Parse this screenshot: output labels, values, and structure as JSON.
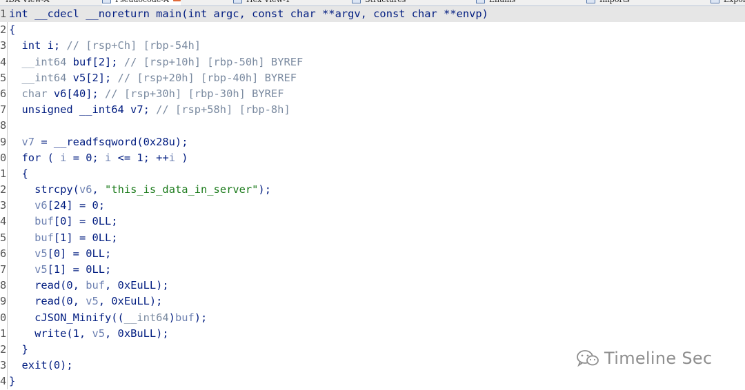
{
  "tabs": [
    {
      "label": "IDA View-A",
      "active": false
    },
    {
      "label": "Pseudocode-A",
      "active": true
    },
    {
      "label": "Hex View-1",
      "active": false
    },
    {
      "label": "Structures",
      "active": false
    },
    {
      "label": "Enums",
      "active": false
    },
    {
      "label": "Imports",
      "active": false
    },
    {
      "label": "Exports",
      "active": false
    }
  ],
  "code_lines": [
    {
      "no": "1",
      "hl": true,
      "parts": [
        [
          "k",
          "int __cdecl __noreturn main(int argc, const char **argv, const char **envp)"
        ]
      ]
    },
    {
      "no": "2",
      "parts": [
        [
          "k",
          "{"
        ]
      ]
    },
    {
      "no": "3",
      "parts": [
        [
          "k",
          "  int i; "
        ],
        [
          "c",
          "// [rsp+Ch] [rbp-54h]"
        ]
      ]
    },
    {
      "no": "4",
      "parts": [
        [
          "c",
          "  __int64 "
        ],
        [
          "k",
          "buf[2]; "
        ],
        [
          "c",
          "// [rsp+10h] [rbp-50h] BYREF"
        ]
      ]
    },
    {
      "no": "5",
      "parts": [
        [
          "c",
          "  __int64 "
        ],
        [
          "k",
          "v5[2]; "
        ],
        [
          "c",
          "// [rsp+20h] [rbp-40h] BYREF"
        ]
      ]
    },
    {
      "no": "6",
      "parts": [
        [
          "c",
          "  char "
        ],
        [
          "k",
          "v6[40]; "
        ],
        [
          "c",
          "// [rsp+30h] [rbp-30h] BYREF"
        ]
      ]
    },
    {
      "no": "7",
      "parts": [
        [
          "k",
          "  unsigned __int64 v7; "
        ],
        [
          "c",
          "// [rsp+58h] [rbp-8h]"
        ]
      ]
    },
    {
      "no": "8",
      "parts": [
        [
          "k",
          ""
        ]
      ]
    },
    {
      "no": "9",
      "parts": [
        [
          "v",
          "  v7"
        ],
        [
          "k",
          " = __readfsqword(0x28u);"
        ]
      ]
    },
    {
      "no": "0",
      "parts": [
        [
          "k",
          "  for ( "
        ],
        [
          "v",
          "i"
        ],
        [
          "k",
          " = 0; "
        ],
        [
          "v",
          "i"
        ],
        [
          "k",
          " <= 1; ++"
        ],
        [
          "v",
          "i"
        ],
        [
          "k",
          " )"
        ]
      ]
    },
    {
      "no": "1",
      "parts": [
        [
          "k",
          "  {"
        ]
      ]
    },
    {
      "no": "2",
      "parts": [
        [
          "k",
          "    strcpy("
        ],
        [
          "v",
          "v6"
        ],
        [
          "k",
          ", "
        ],
        [
          "s",
          "\"this_is_data_in_server\""
        ],
        [
          "k",
          ");"
        ]
      ]
    },
    {
      "no": "3",
      "parts": [
        [
          "v",
          "    v6"
        ],
        [
          "k",
          "[24] = 0;"
        ]
      ]
    },
    {
      "no": "4",
      "parts": [
        [
          "v",
          "    buf"
        ],
        [
          "k",
          "[0] = 0LL;"
        ]
      ]
    },
    {
      "no": "5",
      "parts": [
        [
          "v",
          "    buf"
        ],
        [
          "k",
          "[1] = 0LL;"
        ]
      ]
    },
    {
      "no": "6",
      "parts": [
        [
          "v",
          "    v5"
        ],
        [
          "k",
          "[0] = 0LL;"
        ]
      ]
    },
    {
      "no": "7",
      "parts": [
        [
          "v",
          "    v5"
        ],
        [
          "k",
          "[1] = 0LL;"
        ]
      ]
    },
    {
      "no": "8",
      "parts": [
        [
          "k",
          "    read(0, "
        ],
        [
          "v",
          "buf"
        ],
        [
          "k",
          ", 0xEuLL);"
        ]
      ]
    },
    {
      "no": "9",
      "parts": [
        [
          "k",
          "    read(0, "
        ],
        [
          "v",
          "v5"
        ],
        [
          "k",
          ", 0xEuLL);"
        ]
      ]
    },
    {
      "no": "0",
      "parts": [
        [
          "k",
          "    cJSON_Minify(("
        ],
        [
          "c",
          "__int64"
        ],
        [
          "k",
          ")"
        ],
        [
          "v",
          "buf"
        ],
        [
          "k",
          ");"
        ]
      ]
    },
    {
      "no": "1",
      "parts": [
        [
          "k",
          "    write(1, "
        ],
        [
          "v",
          "v5"
        ],
        [
          "k",
          ", 0xBuLL);"
        ]
      ]
    },
    {
      "no": "2",
      "parts": [
        [
          "k",
          "  }"
        ]
      ]
    },
    {
      "no": "3",
      "parts": [
        [
          "k",
          "  exit(0);"
        ]
      ]
    },
    {
      "no": "4",
      "parts": [
        [
          "k",
          "}"
        ]
      ]
    }
  ],
  "watermark": {
    "text": "Timeline Sec",
    "icon": "wechat-icon"
  },
  "colors": {
    "keyword": "#001c80",
    "comment": "#7a8aa0",
    "variable": "#6b7fb0",
    "string": "#1a7a1a",
    "highlight": "#e6e6e6"
  }
}
